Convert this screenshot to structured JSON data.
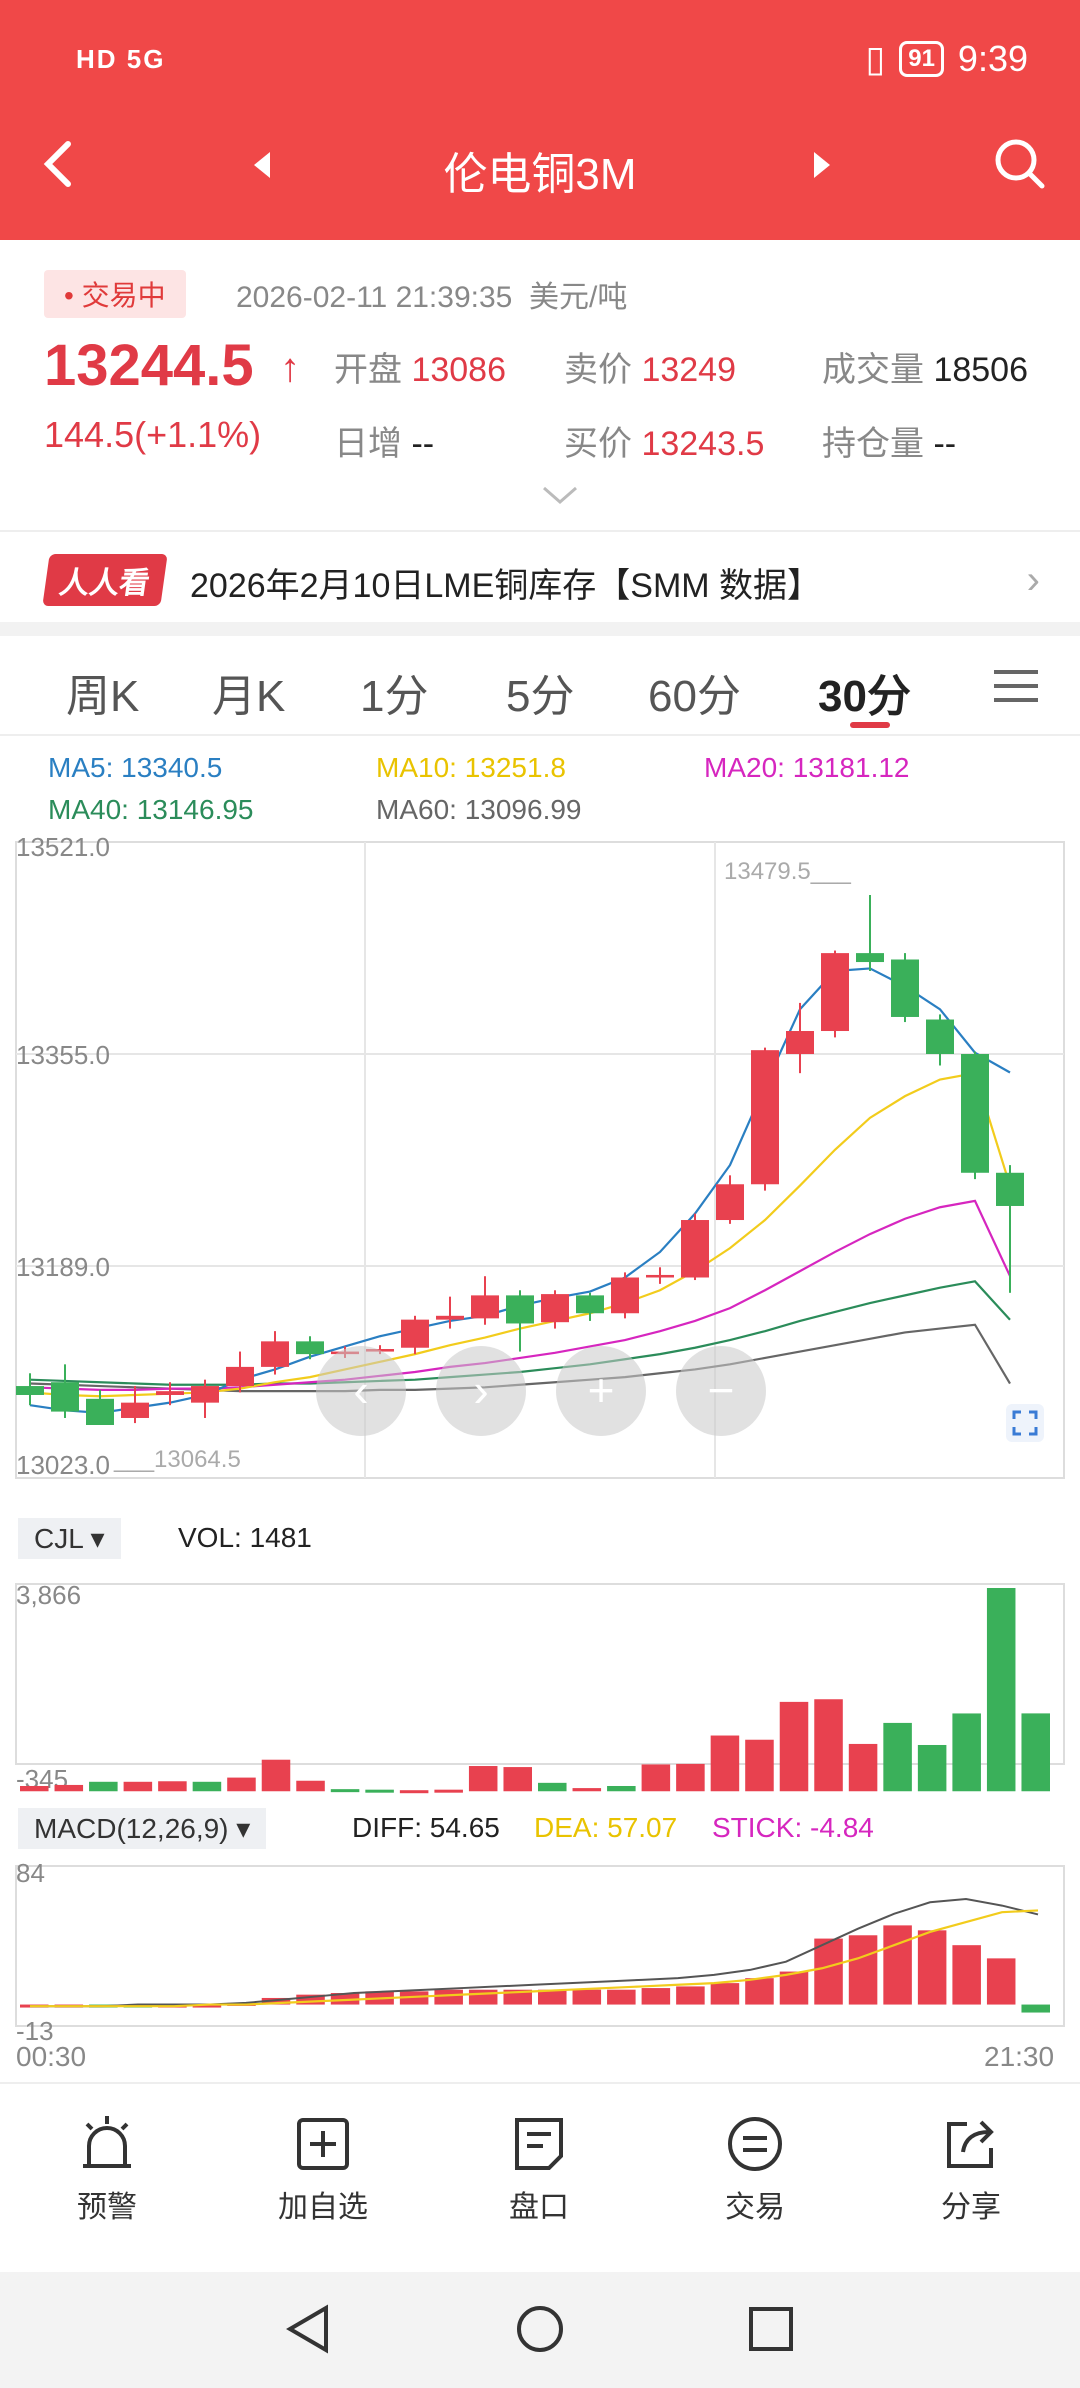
{
  "status_bar": {
    "left": "HD 5G",
    "battery": "91",
    "time": "9:39"
  },
  "header": {
    "title": "伦电铜3M"
  },
  "quote": {
    "status": "• 交易中",
    "datetime": "2026-02-11 21:39:35",
    "unit": "美元/吨",
    "price": "13244.5",
    "change": "144.5(+1.1%)",
    "open_label": "开盘",
    "open_value": "13086",
    "sell_label": "卖价",
    "sell_value": "13249",
    "volume_label": "成交量",
    "volume_value": "18506",
    "daily_inc_label": "日增",
    "daily_inc_value": "--",
    "buy_label": "买价",
    "buy_value": "13243.5",
    "oi_label": "持仓量",
    "oi_value": "--"
  },
  "news": {
    "tag": "人人看",
    "text": "2026年2月10日LME铜库存【SMM 数据】"
  },
  "tabs": [
    {
      "label": "周K",
      "active": false
    },
    {
      "label": "月K",
      "active": false
    },
    {
      "label": "1分",
      "active": false
    },
    {
      "label": "5分",
      "active": false
    },
    {
      "label": "60分",
      "active": false
    },
    {
      "label": "30分",
      "active": true
    }
  ],
  "ma": {
    "ma5": "MA5: 13340.5",
    "ma10": "MA10: 13251.8",
    "ma20": "MA20: 13181.12",
    "ma40": "MA40: 13146.95",
    "ma60": "MA60: 13096.99"
  },
  "colors": {
    "up": "#e8414f",
    "down": "#3ab05a",
    "ma5": "#2a7fc2",
    "ma10": "#f2cc1c",
    "ma20": "#d626bf",
    "ma40": "#2b8c5a",
    "ma60": "#666666",
    "header": "#f04848"
  },
  "chart_data": [
    {
      "type": "candlestick",
      "y_ticks": [
        "13521.0",
        "13355.0",
        "13189.0",
        "13023.0"
      ],
      "ylim": [
        13023.0,
        13521.0
      ],
      "max_label": "13479.5",
      "min_label": "13064.5",
      "candles": [
        {
          "o": 13095,
          "c": 13088,
          "h": 13105,
          "l": 13080
        },
        {
          "o": 13098,
          "c": 13075,
          "h": 13112,
          "l": 13070
        },
        {
          "o": 13085,
          "c": 13064.5,
          "h": 13092,
          "l": 13064.5
        },
        {
          "o": 13070,
          "c": 13082,
          "h": 13095,
          "l": 13066
        },
        {
          "o": 13088,
          "c": 13091,
          "h": 13098,
          "l": 13080
        },
        {
          "o": 13082,
          "c": 13095,
          "h": 13100,
          "l": 13070
        },
        {
          "o": 13095,
          "c": 13110,
          "h": 13122,
          "l": 13090
        },
        {
          "o": 13110,
          "c": 13130,
          "h": 13138,
          "l": 13104
        },
        {
          "o": 13130,
          "c": 13120,
          "h": 13134,
          "l": 13116
        },
        {
          "o": 13120,
          "c": 13122,
          "h": 13126,
          "l": 13117
        },
        {
          "o": 13122,
          "c": 13124,
          "h": 13127,
          "l": 13120
        },
        {
          "o": 13125,
          "c": 13147,
          "h": 13150,
          "l": 13120
        },
        {
          "o": 13147,
          "c": 13150,
          "h": 13165,
          "l": 13140
        },
        {
          "o": 13148,
          "c": 13166,
          "h": 13181,
          "l": 13143
        },
        {
          "o": 13166,
          "c": 13144,
          "h": 13170,
          "l": 13122
        },
        {
          "o": 13145,
          "c": 13167,
          "h": 13170,
          "l": 13140
        },
        {
          "o": 13166,
          "c": 13152,
          "h": 13168,
          "l": 13146
        },
        {
          "o": 13152,
          "c": 13180,
          "h": 13184,
          "l": 13148
        },
        {
          "o": 13180,
          "c": 13182,
          "h": 13188,
          "l": 13175
        },
        {
          "o": 13180,
          "c": 13225,
          "h": 13230,
          "l": 13178
        },
        {
          "o": 13225,
          "c": 13253,
          "h": 13260,
          "l": 13222
        },
        {
          "o": 13253,
          "c": 13358,
          "h": 13360,
          "l": 13248
        },
        {
          "o": 13355,
          "c": 13373,
          "h": 13395,
          "l": 13340
        },
        {
          "o": 13373,
          "c": 13434,
          "h": 13436,
          "l": 13368
        },
        {
          "o": 13434,
          "c": 13427,
          "h": 13479.5,
          "l": 13420
        },
        {
          "o": 13429,
          "c": 13384,
          "h": 13434,
          "l": 13380
        },
        {
          "o": 13382,
          "c": 13355,
          "h": 13386,
          "l": 13346
        },
        {
          "o": 13355,
          "c": 13262,
          "h": 13357,
          "l": 13257
        },
        {
          "o": 13262,
          "c": 13236,
          "h": 13268,
          "l": 13168
        }
      ],
      "ma5": [
        13080,
        13076,
        13074,
        13078,
        13082,
        13088,
        13100,
        13108,
        13118,
        13126,
        13134,
        13140,
        13146,
        13150,
        13158,
        13164,
        13169,
        13180,
        13200,
        13230,
        13268,
        13330,
        13390,
        13420,
        13422,
        13408,
        13390,
        13356,
        13340.5
      ],
      "ma10": [
        13090,
        13088,
        13087,
        13088,
        13089,
        13090,
        13093,
        13098,
        13102,
        13108,
        13114,
        13120,
        13127,
        13133,
        13140,
        13146,
        13152,
        13160,
        13170,
        13185,
        13203,
        13225,
        13252,
        13280,
        13305,
        13322,
        13335,
        13340,
        13251.8
      ],
      "ma20": [
        13094,
        13093,
        13092,
        13092,
        13093,
        13093,
        13094,
        13096,
        13098,
        13100,
        13103,
        13106,
        13110,
        13113,
        13117,
        13121,
        13126,
        13131,
        13138,
        13146,
        13156,
        13170,
        13185,
        13200,
        13214,
        13226,
        13235,
        13240,
        13181.12
      ],
      "ma40": [
        13100,
        13099,
        13098,
        13097,
        13096,
        13096,
        13096,
        13097,
        13097,
        13098,
        13099,
        13100,
        13102,
        13104,
        13106,
        13109,
        13112,
        13116,
        13120,
        13125,
        13131,
        13138,
        13146,
        13153,
        13160,
        13166,
        13172,
        13177,
        13146.95
      ],
      "ma60": [
        13097,
        13096,
        13095,
        13094,
        13093,
        13092,
        13091,
        13091,
        13091,
        13091,
        13092,
        13092,
        13093,
        13094,
        13096,
        13098,
        13100,
        13102,
        13105,
        13108,
        13112,
        13117,
        13122,
        13127,
        13132,
        13137,
        13140,
        13143,
        13096.99
      ]
    },
    {
      "type": "bar",
      "name": "CJL",
      "vol_label": "VOL: 1481",
      "y_ticks": [
        "3,866",
        "-345"
      ],
      "ylim": [
        -345,
        3866
      ],
      "values": [
        100,
        120,
        180,
        180,
        190,
        180,
        260,
        600,
        200,
        40,
        30,
        20,
        30,
        480,
        460,
        160,
        60,
        100,
        510,
        520,
        1060,
        980,
        1700,
        1750,
        900,
        1300,
        880,
        1480,
        3866,
        1481
      ],
      "directions": [
        "up",
        "up",
        "down",
        "up",
        "up",
        "down",
        "up",
        "up",
        "up",
        "down",
        "down",
        "up",
        "up",
        "up",
        "up",
        "down",
        "up",
        "down",
        "up",
        "up",
        "up",
        "up",
        "up",
        "up",
        "up",
        "down",
        "down",
        "down",
        "down",
        "down"
      ]
    },
    {
      "type": "bar",
      "name": "MACD(12,26,9)",
      "diff_label": "DIFF: 54.65",
      "dea_label": "DEA: 57.07",
      "stick_label": "STICK: -4.84",
      "y_ticks": [
        "84",
        "-13"
      ],
      "ylim": [
        -13,
        84
      ],
      "x_ticks": [
        "00:30",
        "21:30"
      ],
      "stick": [
        0,
        0,
        -1,
        -1,
        0,
        0,
        1,
        4,
        6,
        7,
        8,
        8,
        9,
        9,
        9,
        9,
        9,
        9,
        10,
        11,
        13,
        16,
        20,
        40,
        42,
        48,
        45,
        36,
        28,
        -4.84
      ],
      "diff": [
        -1,
        -1,
        -1,
        0,
        0,
        0,
        1,
        3,
        5,
        7,
        8,
        9,
        10,
        11,
        12,
        13,
        14,
        15,
        16,
        18,
        21,
        26,
        36,
        46,
        55,
        62,
        64,
        60,
        54.65
      ],
      "dea": [
        -1,
        -1,
        -1,
        -1,
        -1,
        0,
        0,
        1,
        2,
        3,
        4,
        5,
        6,
        7,
        8,
        9,
        10,
        11,
        12,
        13,
        15,
        18,
        22,
        28,
        36,
        44,
        50,
        56,
        57.07
      ]
    }
  ],
  "toolbar": [
    {
      "label": "预警",
      "icon": "alarm-icon"
    },
    {
      "label": "加自选",
      "icon": "add-box-icon"
    },
    {
      "label": "盘口",
      "icon": "document-icon"
    },
    {
      "label": "交易",
      "icon": "trade-icon"
    },
    {
      "label": "分享",
      "icon": "share-icon"
    }
  ]
}
